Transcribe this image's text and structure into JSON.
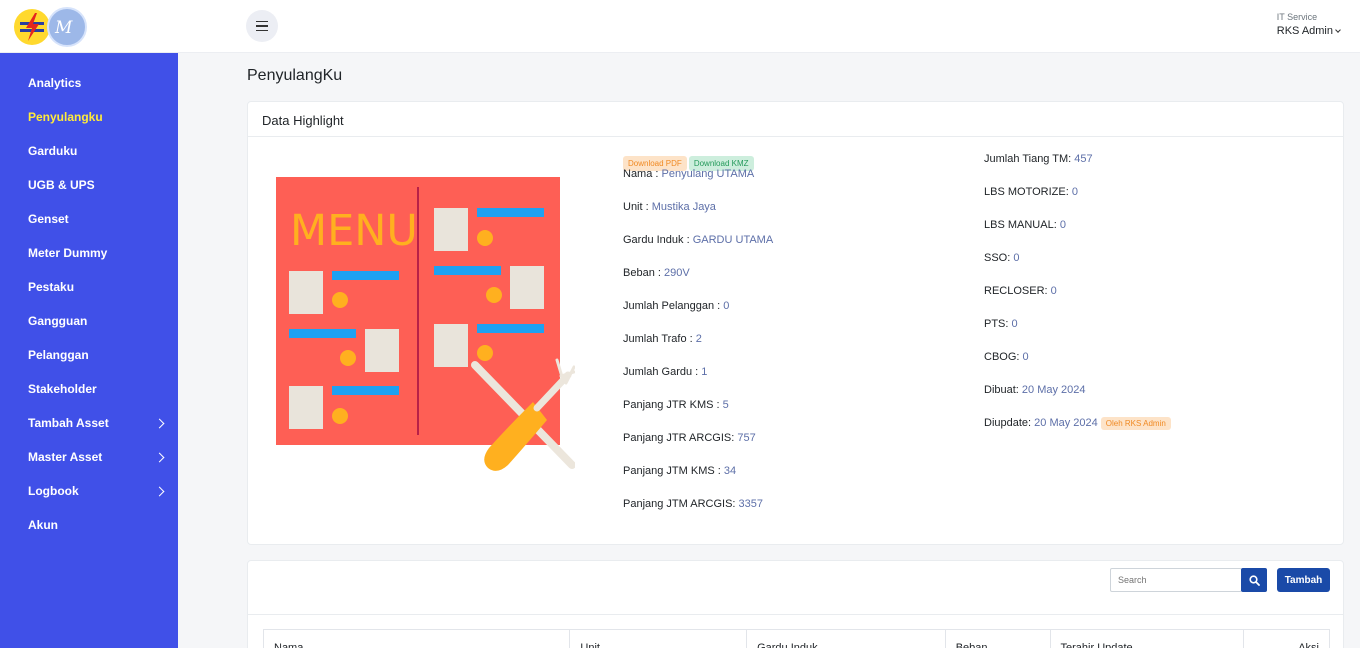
{
  "logo": {
    "left_text": "",
    "right_text": "M"
  },
  "sidebar": {
    "items": [
      {
        "label": "Analytics",
        "active": false,
        "has_children": false
      },
      {
        "label": "Penyulangku",
        "active": true,
        "has_children": false
      },
      {
        "label": "Garduku",
        "active": false,
        "has_children": false
      },
      {
        "label": "UGB & UPS",
        "active": false,
        "has_children": false
      },
      {
        "label": "Genset",
        "active": false,
        "has_children": false
      },
      {
        "label": "Meter Dummy",
        "active": false,
        "has_children": false
      },
      {
        "label": "Pestaku",
        "active": false,
        "has_children": false
      },
      {
        "label": "Gangguan",
        "active": false,
        "has_children": false
      },
      {
        "label": "Pelanggan",
        "active": false,
        "has_children": false
      },
      {
        "label": "Stakeholder",
        "active": false,
        "has_children": false
      },
      {
        "label": "Tambah Asset",
        "active": false,
        "has_children": true
      },
      {
        "label": "Master Asset",
        "active": false,
        "has_children": true
      },
      {
        "label": "Logbook",
        "active": false,
        "has_children": true
      },
      {
        "label": "Akun",
        "active": false,
        "has_children": false
      }
    ]
  },
  "header": {
    "role": "IT Service",
    "user": "RKS Admin"
  },
  "page": {
    "title": "PenyulangKu"
  },
  "highlight": {
    "title": "Data Highlight",
    "illustration_text": "MENU",
    "download_pdf": "Download PDF",
    "download_kmz": "Download KMZ",
    "left": [
      {
        "label": "Nama : ",
        "value": "Penyulang UTAMA"
      },
      {
        "label": "Unit : ",
        "value": "Mustika Jaya"
      },
      {
        "label": "Gardu Induk : ",
        "value": "GARDU UTAMA"
      },
      {
        "label": "Beban : ",
        "value": "290V"
      },
      {
        "label": "Jumlah Pelanggan : ",
        "value": "0"
      },
      {
        "label": "Jumlah Trafo : ",
        "value": "2"
      },
      {
        "label": "Jumlah Gardu : ",
        "value": "1"
      },
      {
        "label": "Panjang JTR KMS : ",
        "value": "5"
      },
      {
        "label": "Panjang JTR ARCGIS: ",
        "value": "757"
      },
      {
        "label": "Panjang JTM KMS : ",
        "value": "34"
      },
      {
        "label": "Panjang JTM ARCGIS: ",
        "value": "3357"
      }
    ],
    "right": [
      {
        "label": "Jumlah Tiang TM: ",
        "value": "457"
      },
      {
        "label": "LBS MOTORIZE: ",
        "value": "0"
      },
      {
        "label": "LBS MANUAL: ",
        "value": "0"
      },
      {
        "label": "SSO: ",
        "value": "0"
      },
      {
        "label": "RECLOSER: ",
        "value": "0"
      },
      {
        "label": "PTS: ",
        "value": "0"
      },
      {
        "label": "CBOG: ",
        "value": "0"
      },
      {
        "label": "Dibuat: ",
        "value": "20 May 2024"
      },
      {
        "label": "Diupdate: ",
        "value": "20 May 2024"
      }
    ],
    "updated_by": "Oleh RKS Admin"
  },
  "table": {
    "search_placeholder": "Search",
    "add_label": "Tambah",
    "columns": [
      "Nama",
      "Unit",
      "Gardu Induk",
      "Beban",
      "Terahir Update",
      "Aksi"
    ]
  },
  "colors": {
    "sidebar": "#4050e8",
    "active": "#ffeb3b",
    "primary": "#1a4aa8"
  }
}
